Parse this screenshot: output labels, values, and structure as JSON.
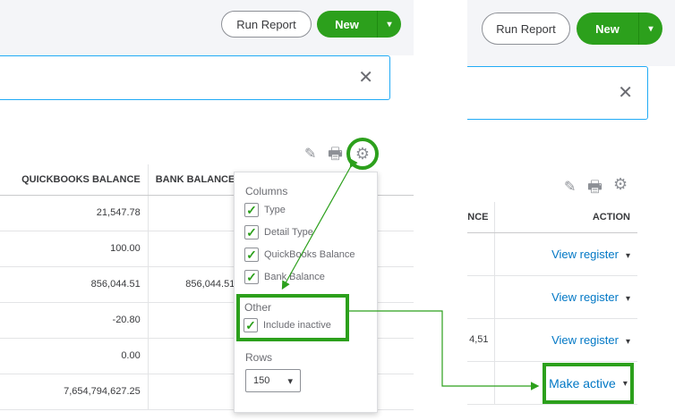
{
  "toolbar": {
    "run_report": "Run Report",
    "new": "New",
    "caret": "▾"
  },
  "search": {
    "clear": "✕"
  },
  "tools": {
    "pencil": "✎",
    "printer": "🖶",
    "gear": "⚙"
  },
  "left_table": {
    "headers": [
      "QUICKBOOKS BALANCE",
      "BANK BALANCE"
    ],
    "rows": [
      [
        "21,547.78",
        ""
      ],
      [
        "100.00",
        ""
      ],
      [
        "856,044.51",
        "856,044.51"
      ],
      [
        "-20.80",
        ""
      ],
      [
        "0.00",
        ""
      ],
      [
        "7,654,794,627.25",
        ""
      ]
    ]
  },
  "popup": {
    "columns_heading": "Columns",
    "columns": [
      "Type",
      "Detail Type",
      "QuickBooks Balance",
      "Bank Balance"
    ],
    "other_heading": "Other",
    "other": [
      "Include inactive"
    ],
    "rows_heading": "Rows",
    "rows_value": "150",
    "check": "✓"
  },
  "right_table": {
    "headers": [
      "NCE",
      "ACTION"
    ],
    "rows": [
      {
        "balance": "",
        "action": "View register"
      },
      {
        "balance": "",
        "action": "View register"
      },
      {
        "balance": "4,51",
        "action": "View register"
      },
      {
        "balance": "",
        "action": "Make active"
      }
    ]
  },
  "colors": {
    "accent_green": "#2ca01c",
    "link_blue": "#0077c5",
    "focus_blue": "#21abf6"
  }
}
